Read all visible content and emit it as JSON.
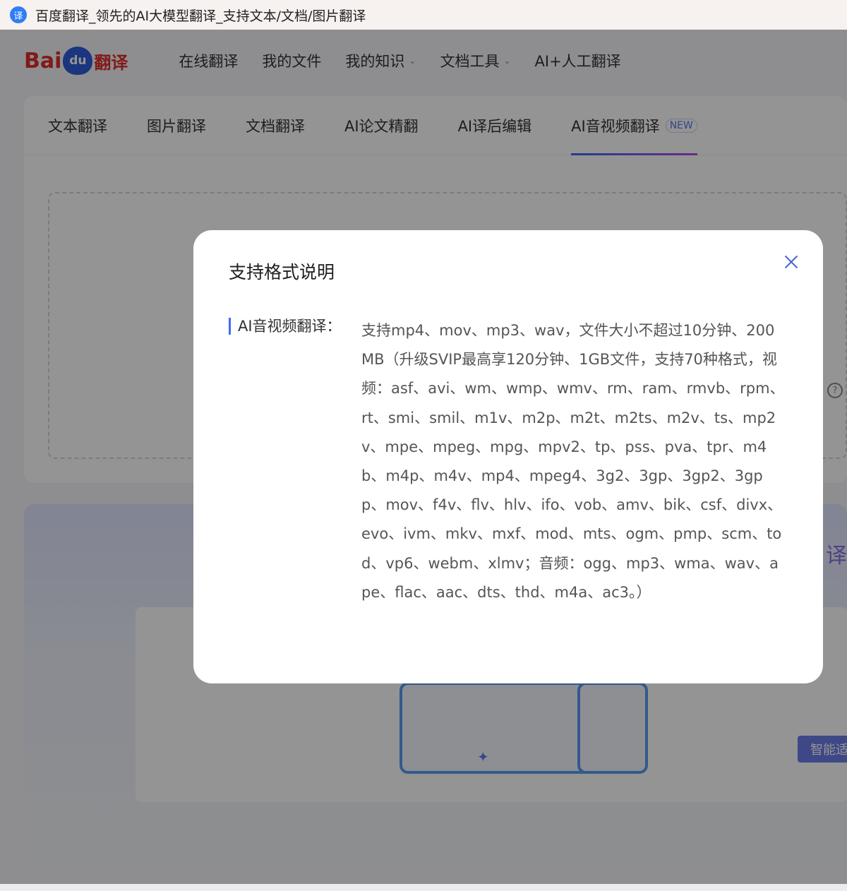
{
  "window": {
    "title": "百度翻译_领先的AI大模型翻译_支持文本/文档/图片翻译",
    "icon_glyph": "译"
  },
  "logo": {
    "bai": "Bai",
    "du": "du",
    "suffix": "翻译"
  },
  "topnav": {
    "items": [
      {
        "label": "在线翻译"
      },
      {
        "label": "我的文件"
      },
      {
        "label": "我的知识",
        "has_dropdown": true
      },
      {
        "label": "文档工具",
        "has_dropdown": true
      },
      {
        "label": "AI+人工翻译"
      }
    ]
  },
  "tabs": {
    "items": [
      {
        "label": "文本翻译"
      },
      {
        "label": "图片翻译"
      },
      {
        "label": "文档翻译"
      },
      {
        "label": "AI论文精翻"
      },
      {
        "label": "AI译后编辑"
      },
      {
        "label": "AI音视频翻译",
        "badge": "NEW",
        "active": true
      }
    ]
  },
  "promo": {
    "smart_button": "智能适配",
    "side_char": "译"
  },
  "modal": {
    "title": "支持格式说明",
    "label": "AI音视频翻译：",
    "text": "支持mp4、mov、mp3、wav，文件大小不超过10分钟、200MB（升级SVIP最高享120分钟、1GB文件，支持70种格式，视频：asf、avi、wm、wmp、wmv、rm、ram、rmvb、rpm、rt、smi、smil、m1v、m2p、m2t、m2ts、m2v、ts、mp2v、mpe、mpeg、mpg、mpv2、tp、pss、pva、tpr、m4b、m4p、m4v、mp4、mpeg4、3g2、3gp、3gp2、3gpp、mov、f4v、flv、hlv、ifo、vob、amv、bik、csf、divx、evo、ivm、mkv、mxf、mod、mts、ogm、pmp、scm、tod、vp6、webm、xlmv；音频：ogg、mp3、wma、wav、ape、flac、aac、dts、thd、m4a、ac3。）"
  },
  "colors": {
    "accent": "#3c6cf5",
    "close_icon": "#4a63d9",
    "brand_red": "#de2d2b"
  }
}
